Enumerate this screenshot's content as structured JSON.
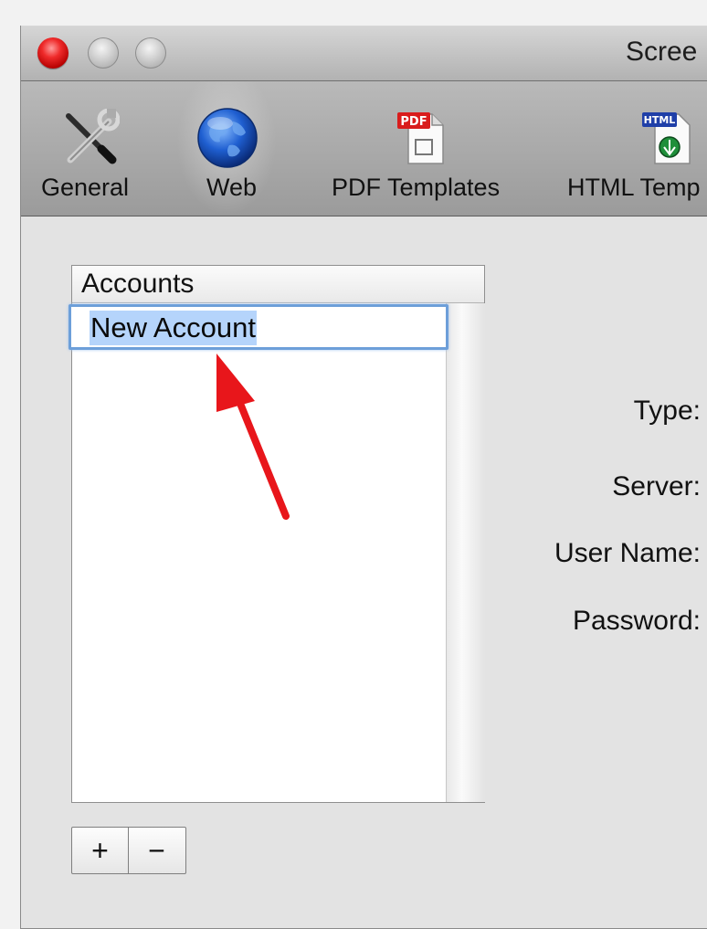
{
  "window": {
    "title": "Scree"
  },
  "toolbar": {
    "items": [
      {
        "label": "General",
        "icon": "tools-icon"
      },
      {
        "label": "Web",
        "icon": "globe-icon"
      },
      {
        "label": "PDF Templates",
        "icon": "pdf-document-icon"
      },
      {
        "label": "HTML Temp",
        "icon": "html-document-icon"
      }
    ]
  },
  "accounts": {
    "header": "Accounts",
    "rows": [
      "New Account"
    ]
  },
  "form": {
    "type_label": "Type:",
    "server_label": "Server:",
    "username_label": "User Name:",
    "password_label": "Password:"
  },
  "buttons": {
    "add": "+",
    "remove": "−"
  },
  "colors": {
    "selection": "#b5d4fb",
    "focus_ring": "#6d9fd9",
    "annotation_arrow": "#e8161b"
  }
}
